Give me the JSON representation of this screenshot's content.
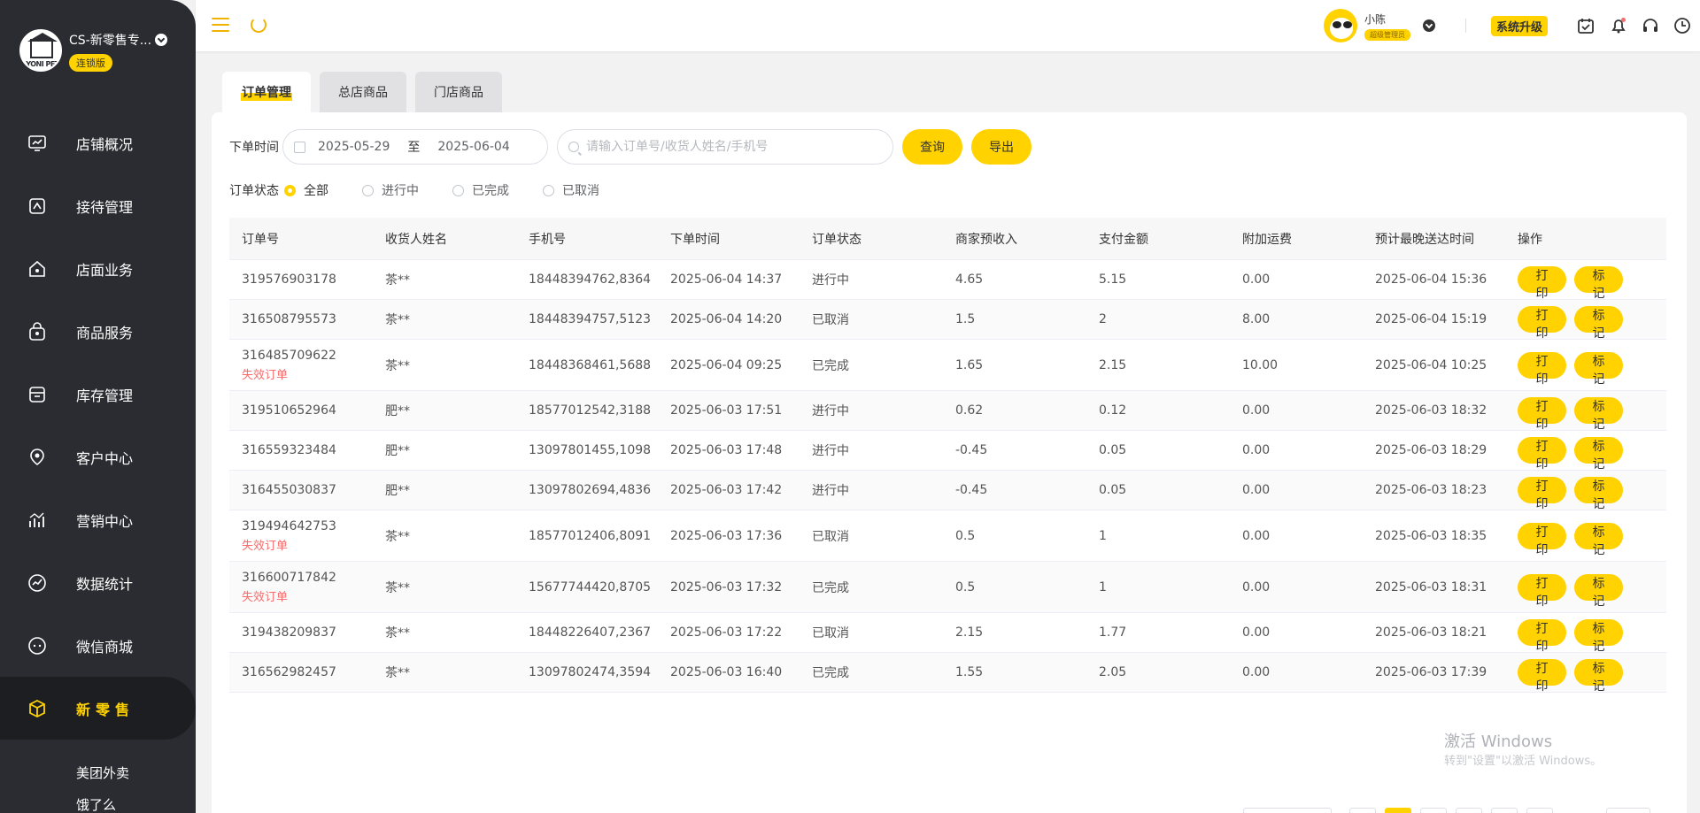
{
  "brand": {
    "name": "CS-新零售专...",
    "badge": "连锁版",
    "logo_text": "YONI PET"
  },
  "sidebar": {
    "items": [
      {
        "label": "店铺概况",
        "icon": "monitor-icon"
      },
      {
        "label": "接待管理",
        "icon": "reception-icon"
      },
      {
        "label": "店面业务",
        "icon": "store-icon"
      },
      {
        "label": "商品服务",
        "icon": "shopping-bag-icon"
      },
      {
        "label": "库存管理",
        "icon": "inventory-icon"
      },
      {
        "label": "客户中心",
        "icon": "customer-icon"
      },
      {
        "label": "营销中心",
        "icon": "marketing-icon"
      },
      {
        "label": "数据统计",
        "icon": "statistics-icon"
      },
      {
        "label": "微信商城",
        "icon": "wechat-icon"
      },
      {
        "label": "新零售",
        "icon": "cube-icon",
        "active": true
      }
    ],
    "sub_items": [
      "美团外卖",
      "饿了么"
    ]
  },
  "header": {
    "user_name": "小陈",
    "user_role": "超级管理员",
    "upgrade_label": "系统升级"
  },
  "tabs": [
    {
      "label": "订单管理",
      "active": true
    },
    {
      "label": "总店商品"
    },
    {
      "label": "门店商品"
    }
  ],
  "filters": {
    "date_label": "下单时间",
    "date_start": "2025-05-29",
    "date_to": "至",
    "date_end": "2025-06-04",
    "search_placeholder": "请输入订单号/收货人姓名/手机号",
    "query_label": "查询",
    "export_label": "导出",
    "status_label": "订单状态",
    "status_options": [
      "全部",
      "进行中",
      "已完成",
      "已取消"
    ],
    "status_selected": "全部"
  },
  "table": {
    "headers": [
      "订单号",
      "收货人姓名",
      "手机号",
      "下单时间",
      "订单状态",
      "商家预收入",
      "支付金额",
      "附加运费",
      "预计最晚送达时间",
      "操作"
    ],
    "print_label": "打印",
    "mark_label": "标记",
    "invalid_label": "失效订单",
    "rows": [
      {
        "order_no": "319576903178",
        "invalid": false,
        "name": "茶**",
        "phone": "18448394762,8364",
        "time": "2025-06-04 14:37",
        "status": "进行中",
        "income": "4.65",
        "paid": "5.15",
        "fee": "0.00",
        "eta": "2025-06-04 15:36"
      },
      {
        "order_no": "316508795573",
        "invalid": false,
        "name": "茶**",
        "phone": "18448394757,5123",
        "time": "2025-06-04 14:20",
        "status": "已取消",
        "income": "1.5",
        "paid": "2",
        "fee": "8.00",
        "eta": "2025-06-04 15:19"
      },
      {
        "order_no": "316485709622",
        "invalid": true,
        "name": "茶**",
        "phone": "18448368461,5688",
        "time": "2025-06-04 09:25",
        "status": "已完成",
        "income": "1.65",
        "paid": "2.15",
        "fee": "10.00",
        "eta": "2025-06-04 10:25"
      },
      {
        "order_no": "319510652964",
        "invalid": false,
        "name": "肥**",
        "phone": "18577012542,3188",
        "time": "2025-06-03 17:51",
        "status": "进行中",
        "income": "0.62",
        "paid": "0.12",
        "fee": "0.00",
        "eta": "2025-06-03 18:32"
      },
      {
        "order_no": "316559323484",
        "invalid": false,
        "name": "肥**",
        "phone": "13097801455,1098",
        "time": "2025-06-03 17:48",
        "status": "进行中",
        "income": "-0.45",
        "paid": "0.05",
        "fee": "0.00",
        "eta": "2025-06-03 18:29"
      },
      {
        "order_no": "316455030837",
        "invalid": false,
        "name": "肥**",
        "phone": "13097802694,4836",
        "time": "2025-06-03 17:42",
        "status": "进行中",
        "income": "-0.45",
        "paid": "0.05",
        "fee": "0.00",
        "eta": "2025-06-03 18:23"
      },
      {
        "order_no": "319494642753",
        "invalid": true,
        "name": "茶**",
        "phone": "18577012406,8091",
        "time": "2025-06-03 17:36",
        "status": "已取消",
        "income": "0.5",
        "paid": "1",
        "fee": "0.00",
        "eta": "2025-06-03 18:35"
      },
      {
        "order_no": "316600717842",
        "invalid": true,
        "name": "茶**",
        "phone": "15677744420,8705",
        "time": "2025-06-03 17:32",
        "status": "已完成",
        "income": "0.5",
        "paid": "1",
        "fee": "0.00",
        "eta": "2025-06-03 18:31"
      },
      {
        "order_no": "319438209837",
        "invalid": false,
        "name": "茶**",
        "phone": "18448226407,2367",
        "time": "2025-06-03 17:22",
        "status": "已取消",
        "income": "2.15",
        "paid": "1.77",
        "fee": "0.00",
        "eta": "2025-06-03 18:21"
      },
      {
        "order_no": "316562982457",
        "invalid": false,
        "name": "茶**",
        "phone": "13097802474,3594",
        "time": "2025-06-03 16:40",
        "status": "已完成",
        "income": "1.55",
        "paid": "2.05",
        "fee": "0.00",
        "eta": "2025-06-03 17:39"
      }
    ]
  },
  "watermark": {
    "line1": "激活 Windows",
    "line2": "转到\"设置\"以激活 Windows。"
  },
  "colors": {
    "accent": "#ffd200",
    "sidebar": "#2b2c31",
    "invalid": "#f56c6c"
  }
}
